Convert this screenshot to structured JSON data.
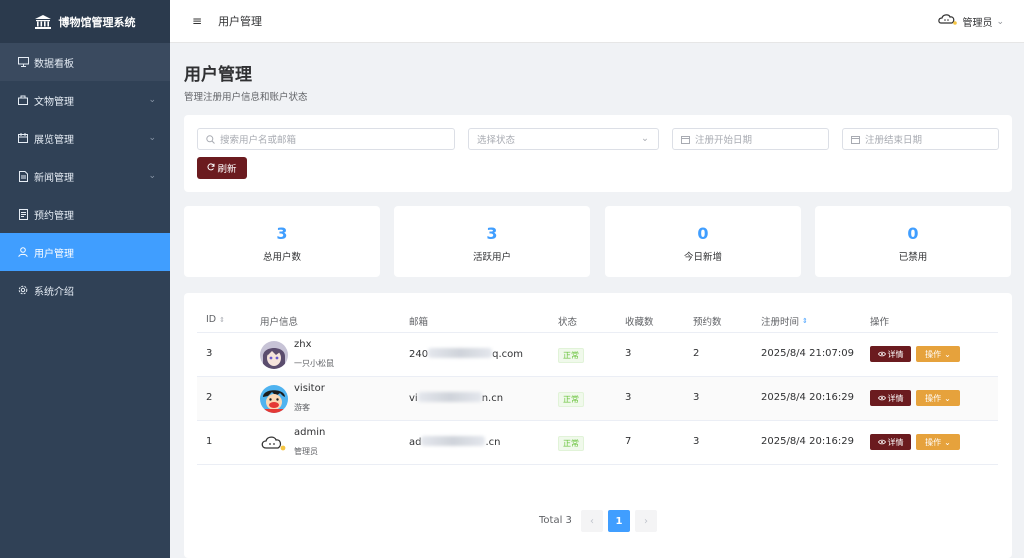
{
  "app": {
    "title": "博物馆管理系统"
  },
  "sidebar": {
    "items": [
      {
        "label": "数据看板",
        "icon": "monitor-icon"
      },
      {
        "label": "文物管理",
        "icon": "bag-icon",
        "expandable": true
      },
      {
        "label": "展览管理",
        "icon": "calendar-icon",
        "expandable": true
      },
      {
        "label": "新闻管理",
        "icon": "document-icon",
        "expandable": true
      },
      {
        "label": "预约管理",
        "icon": "list-icon"
      },
      {
        "label": "用户管理",
        "icon": "user-icon",
        "active": true
      },
      {
        "label": "系统介绍",
        "icon": "gear-icon"
      }
    ]
  },
  "header": {
    "breadcrumb": "用户管理",
    "user_label": "管理员"
  },
  "page": {
    "title": "用户管理",
    "subtitle": "管理注册用户信息和账户状态"
  },
  "filters": {
    "search_placeholder": "搜索用户名或邮箱",
    "status_placeholder": "选择状态",
    "start_date_placeholder": "注册开始日期",
    "end_date_placeholder": "注册结束日期",
    "refresh_label": "刷新"
  },
  "stats": [
    {
      "value": "3",
      "label": "总用户数"
    },
    {
      "value": "3",
      "label": "活跃用户"
    },
    {
      "value": "0",
      "label": "今日新增"
    },
    {
      "value": "0",
      "label": "已禁用"
    }
  ],
  "table": {
    "columns": [
      "ID",
      "用户信息",
      "邮箱",
      "状态",
      "收藏数",
      "预约数",
      "注册时间",
      "操作"
    ],
    "rows": [
      {
        "id": "3",
        "name": "zhx",
        "nickname": "一只小松鼠",
        "email_start": "240",
        "email_end": "q.com",
        "status": "正常",
        "favorites": "3",
        "reservations": "2",
        "registered": "2025/8/4 21:07:09",
        "detail_label": "详情",
        "ops_label": "操作"
      },
      {
        "id": "2",
        "name": "visitor",
        "nickname": "游客",
        "email_start": "vi",
        "email_end": "n.cn",
        "status": "正常",
        "favorites": "3",
        "reservations": "3",
        "registered": "2025/8/4 20:16:29",
        "detail_label": "详情",
        "ops_label": "操作"
      },
      {
        "id": "1",
        "name": "admin",
        "nickname": "管理员",
        "email_start": "ad",
        "email_end": ".cn",
        "status": "正常",
        "favorites": "7",
        "reservations": "3",
        "registered": "2025/8/4 20:16:29",
        "detail_label": "详情",
        "ops_label": "操作"
      }
    ]
  },
  "pagination": {
    "total_label": "Total 3",
    "current_page": "1"
  },
  "colors": {
    "sidebar_bg": "#304156",
    "active": "#409eff",
    "maroon": "#6b1b1f",
    "orange": "#e6a23c",
    "success": "#67c23a"
  }
}
